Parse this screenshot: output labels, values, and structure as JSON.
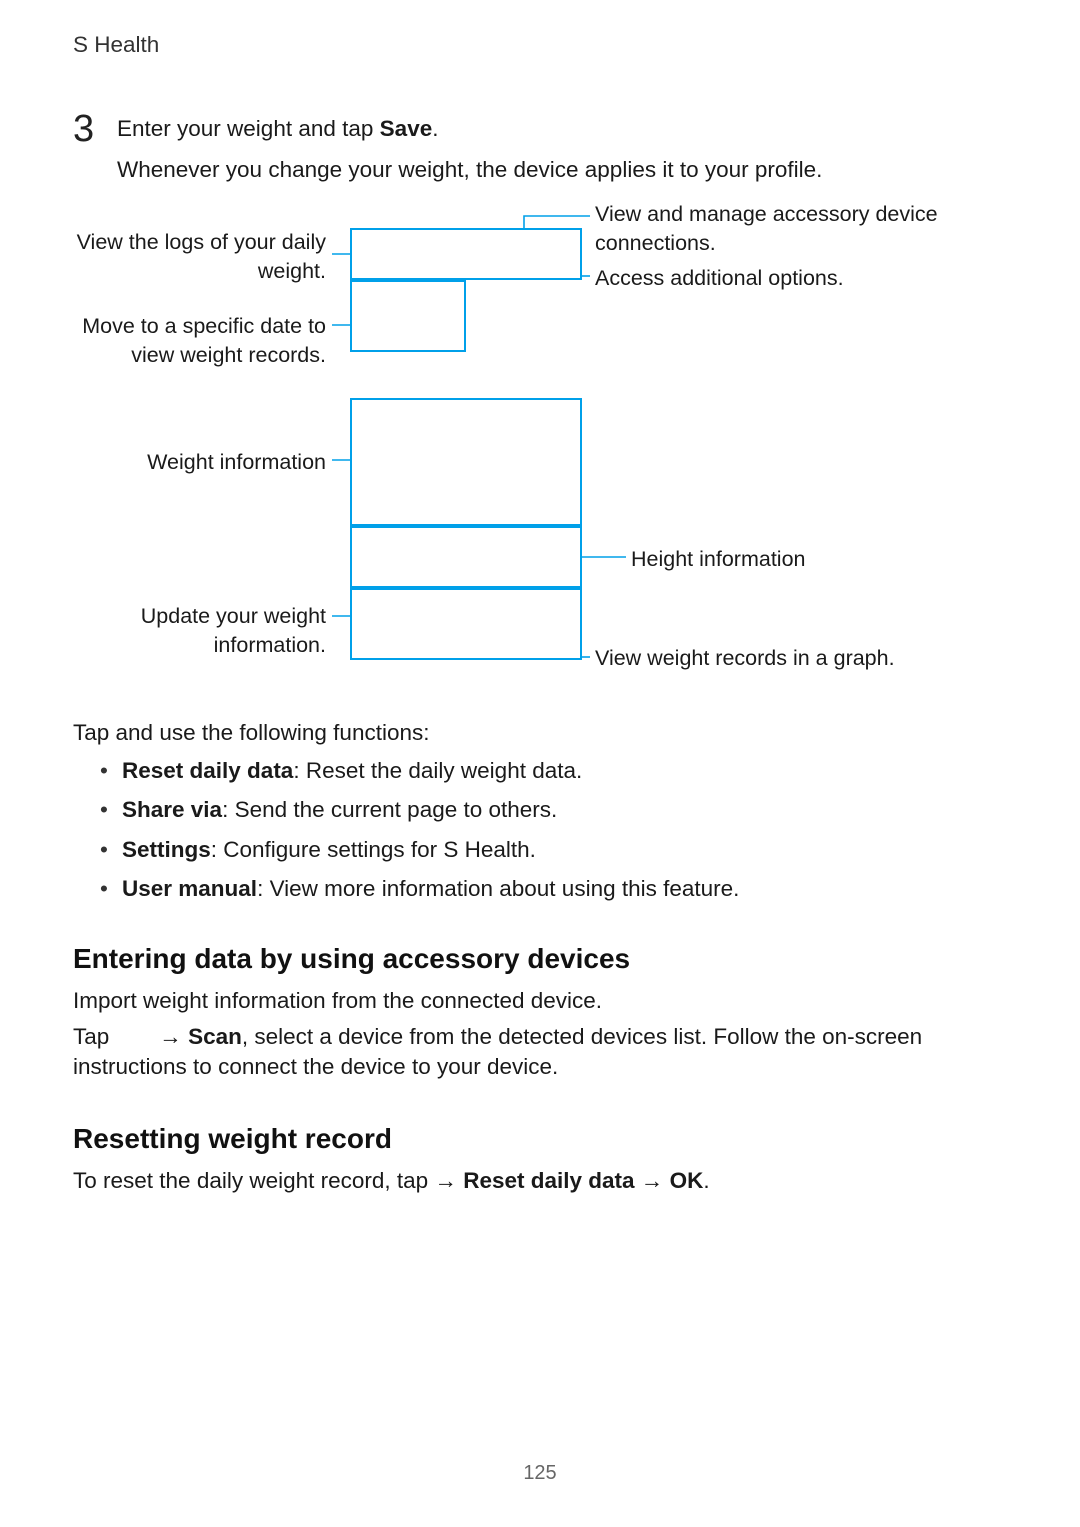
{
  "header": {
    "title": "S Health"
  },
  "step": {
    "number": "3",
    "text_prefix": "Enter your weight and tap ",
    "text_bold": "Save",
    "text_suffix": ".",
    "subtext": "Whenever you change your weight, the device applies it to your profile."
  },
  "callouts": {
    "left": {
      "logs": "View the logs of your daily weight.",
      "date": "Move to a specific date to view weight records.",
      "weight_info": "Weight information",
      "update": "Update your weight information."
    },
    "right": {
      "accessory": "View and manage accessory device connections.",
      "options": "Access additional options.",
      "height_info": "Height information",
      "graph": "View weight records in a graph."
    }
  },
  "after_diagram_para": "Tap   and use the following functions:",
  "bullets": [
    {
      "bold": "Reset daily data",
      "rest": ": Reset the daily weight data."
    },
    {
      "bold": "Share via",
      "rest": ": Send the current page to others."
    },
    {
      "bold": "Settings",
      "rest": ": Configure settings for S Health."
    },
    {
      "bold": "User manual",
      "rest": ": View more information about using this feature."
    }
  ],
  "section_accessory": {
    "heading": "Entering data by using accessory devices",
    "p1": "Import weight information from the connected device.",
    "p2_prefix": "Tap ",
    "p2_arrow": "→ ",
    "p2_bold": "Scan",
    "p2_rest": ", select a device from the detected devices list. Follow the on-screen instructions to connect the device to your device."
  },
  "section_reset": {
    "heading": "Resetting weight record",
    "p_prefix": "To reset the daily weight record, tap   ",
    "arrow1": "→ ",
    "bold1": "Reset daily data",
    "arrow2": " → ",
    "bold2": "OK",
    "suffix": "."
  },
  "page_number": "125"
}
